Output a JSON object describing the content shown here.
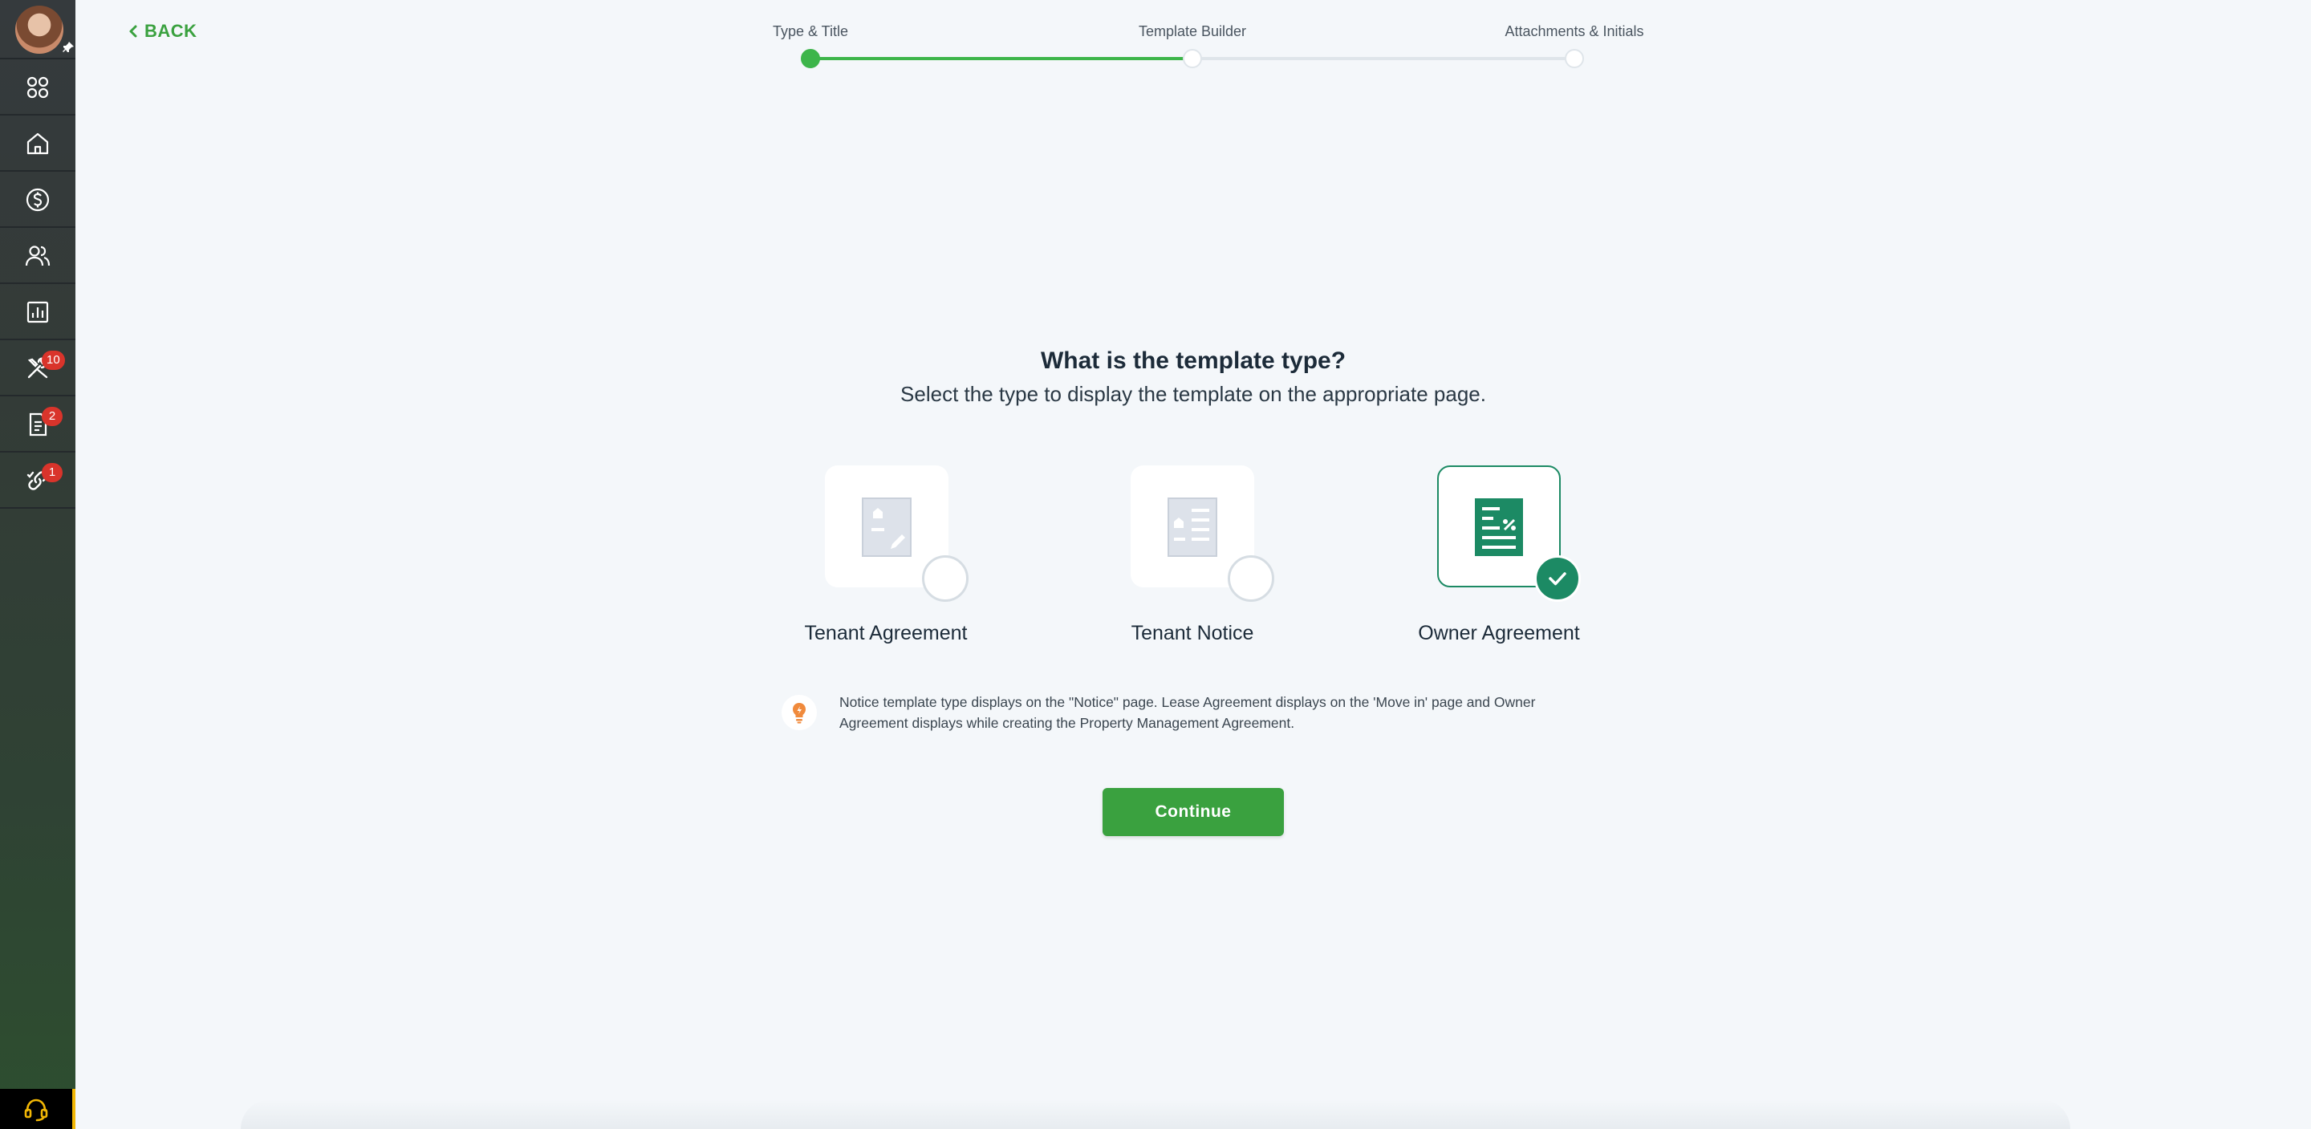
{
  "sidebar": {
    "items": [
      {
        "icon": "apps-grid-icon"
      },
      {
        "icon": "home-icon"
      },
      {
        "icon": "dollar-circle-icon"
      },
      {
        "icon": "people-icon"
      },
      {
        "icon": "bar-chart-icon"
      },
      {
        "icon": "tools-icon",
        "badge": "10"
      },
      {
        "icon": "document-icon",
        "badge": "2"
      },
      {
        "icon": "link-check-icon",
        "badge": "1"
      }
    ],
    "help_icon": "headset-icon",
    "accent_color": "#f2b705"
  },
  "back_label": "BACK",
  "stepper": {
    "steps": [
      "Type & Title",
      "Template Builder",
      "Attachments & Initials"
    ],
    "current_step": 1,
    "active_color": "#3db54a"
  },
  "heading": {
    "title": "What is the template type?",
    "subtitle": "Select the type to display the template on the appropriate page."
  },
  "template_types": [
    {
      "label": "Tenant Agreement",
      "icon": "agreement-doc-icon",
      "selected": false
    },
    {
      "label": "Tenant Notice",
      "icon": "notice-doc-icon",
      "selected": false
    },
    {
      "label": "Owner Agreement",
      "icon": "owner-doc-icon",
      "selected": true
    }
  ],
  "info_text": "Notice template type displays on the \"Notice\" page. Lease Agreement displays on the 'Move in' page and Owner Agreement displays while creating the Property Management Agreement.",
  "continue_label": "Continue",
  "colors": {
    "primary_green": "#3aa13f",
    "selected_teal": "#1c8a64",
    "badge_red": "#d9342b"
  }
}
